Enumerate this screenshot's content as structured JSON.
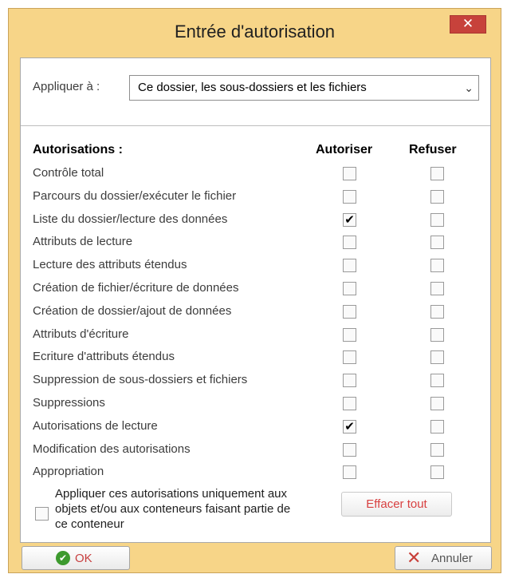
{
  "window": {
    "title": "Entrée d'autorisation",
    "close_glyph": "✕"
  },
  "apply": {
    "label": "Appliquer à :",
    "value": "Ce dossier, les sous-dossiers et les fichiers",
    "chevron_glyph": "⌄"
  },
  "headers": {
    "permissions": "Autorisations :",
    "allow": "Autoriser",
    "deny": "Refuser"
  },
  "permissions": [
    {
      "label": "Contrôle total",
      "allow": false,
      "deny": false
    },
    {
      "label": "Parcours du dossier/exécuter le fichier",
      "allow": false,
      "deny": false
    },
    {
      "label": "Liste du dossier/lecture des données",
      "allow": true,
      "deny": false
    },
    {
      "label": "Attributs de lecture",
      "allow": false,
      "deny": false
    },
    {
      "label": "Lecture des attributs étendus",
      "allow": false,
      "deny": false
    },
    {
      "label": "Création de fichier/écriture de données",
      "allow": false,
      "deny": false
    },
    {
      "label": "Création de dossier/ajout de données",
      "allow": false,
      "deny": false
    },
    {
      "label": "Attributs d'écriture",
      "allow": false,
      "deny": false
    },
    {
      "label": "Ecriture d'attributs étendus",
      "allow": false,
      "deny": false
    },
    {
      "label": "Suppression de sous-dossiers et fichiers",
      "allow": false,
      "deny": false
    },
    {
      "label": "Suppressions",
      "allow": false,
      "deny": false
    },
    {
      "label": "Autorisations de lecture",
      "allow": true,
      "deny": false
    },
    {
      "label": "Modification des autorisations",
      "allow": false,
      "deny": false
    },
    {
      "label": "Appropriation",
      "allow": false,
      "deny": false
    }
  ],
  "apply_only": {
    "text": "Appliquer ces autorisations uniquement aux objets et/ou aux conteneurs faisant partie de ce conteneur",
    "checked": false
  },
  "buttons": {
    "clear_all": "Effacer tout",
    "ok": "OK",
    "cancel": "Annuler"
  },
  "icons": {
    "ok": "check-circle-icon",
    "cancel": "x-icon",
    "ok_color": "#3d9a2e",
    "cancel_color": "#c8403a"
  }
}
